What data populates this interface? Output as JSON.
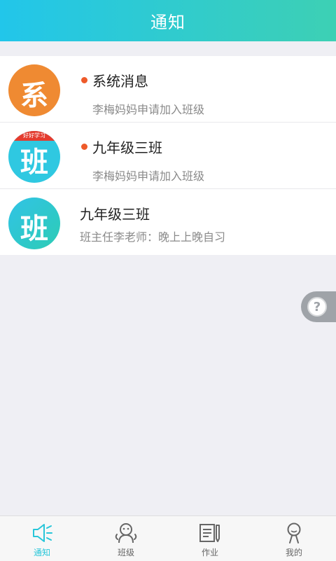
{
  "header": {
    "title": "通知"
  },
  "notifications": [
    {
      "avatar_char": "系",
      "avatar_strip": "",
      "unread": true,
      "title": "系统消息",
      "subtitle": "李梅妈妈申请加入班级"
    },
    {
      "avatar_char": "班",
      "avatar_strip": "好好学习",
      "unread": true,
      "title": "九年级三班",
      "subtitle": "李梅妈妈申请加入班级"
    },
    {
      "avatar_char": "班",
      "avatar_strip": "",
      "unread": false,
      "title": "九年级三班",
      "subtitle": "班主任李老师：晚上上晚自习"
    }
  ],
  "help": {
    "icon": "question-icon",
    "symbol": "?"
  },
  "tabbar": {
    "active_color": "#28c6d9",
    "items": [
      {
        "label": "通知",
        "icon": "speaker-icon",
        "active": true
      },
      {
        "label": "班级",
        "icon": "class-people-icon",
        "active": false
      },
      {
        "label": "作业",
        "icon": "homework-icon",
        "active": false
      },
      {
        "label": "我的",
        "icon": "profile-icon",
        "active": false
      }
    ]
  },
  "colors": {
    "header_gradient_start": "#22c6ea",
    "header_gradient_end": "#3dd0b4",
    "unread_dot": "#ee5a2a",
    "avatar_orange": "#ef8a32"
  }
}
